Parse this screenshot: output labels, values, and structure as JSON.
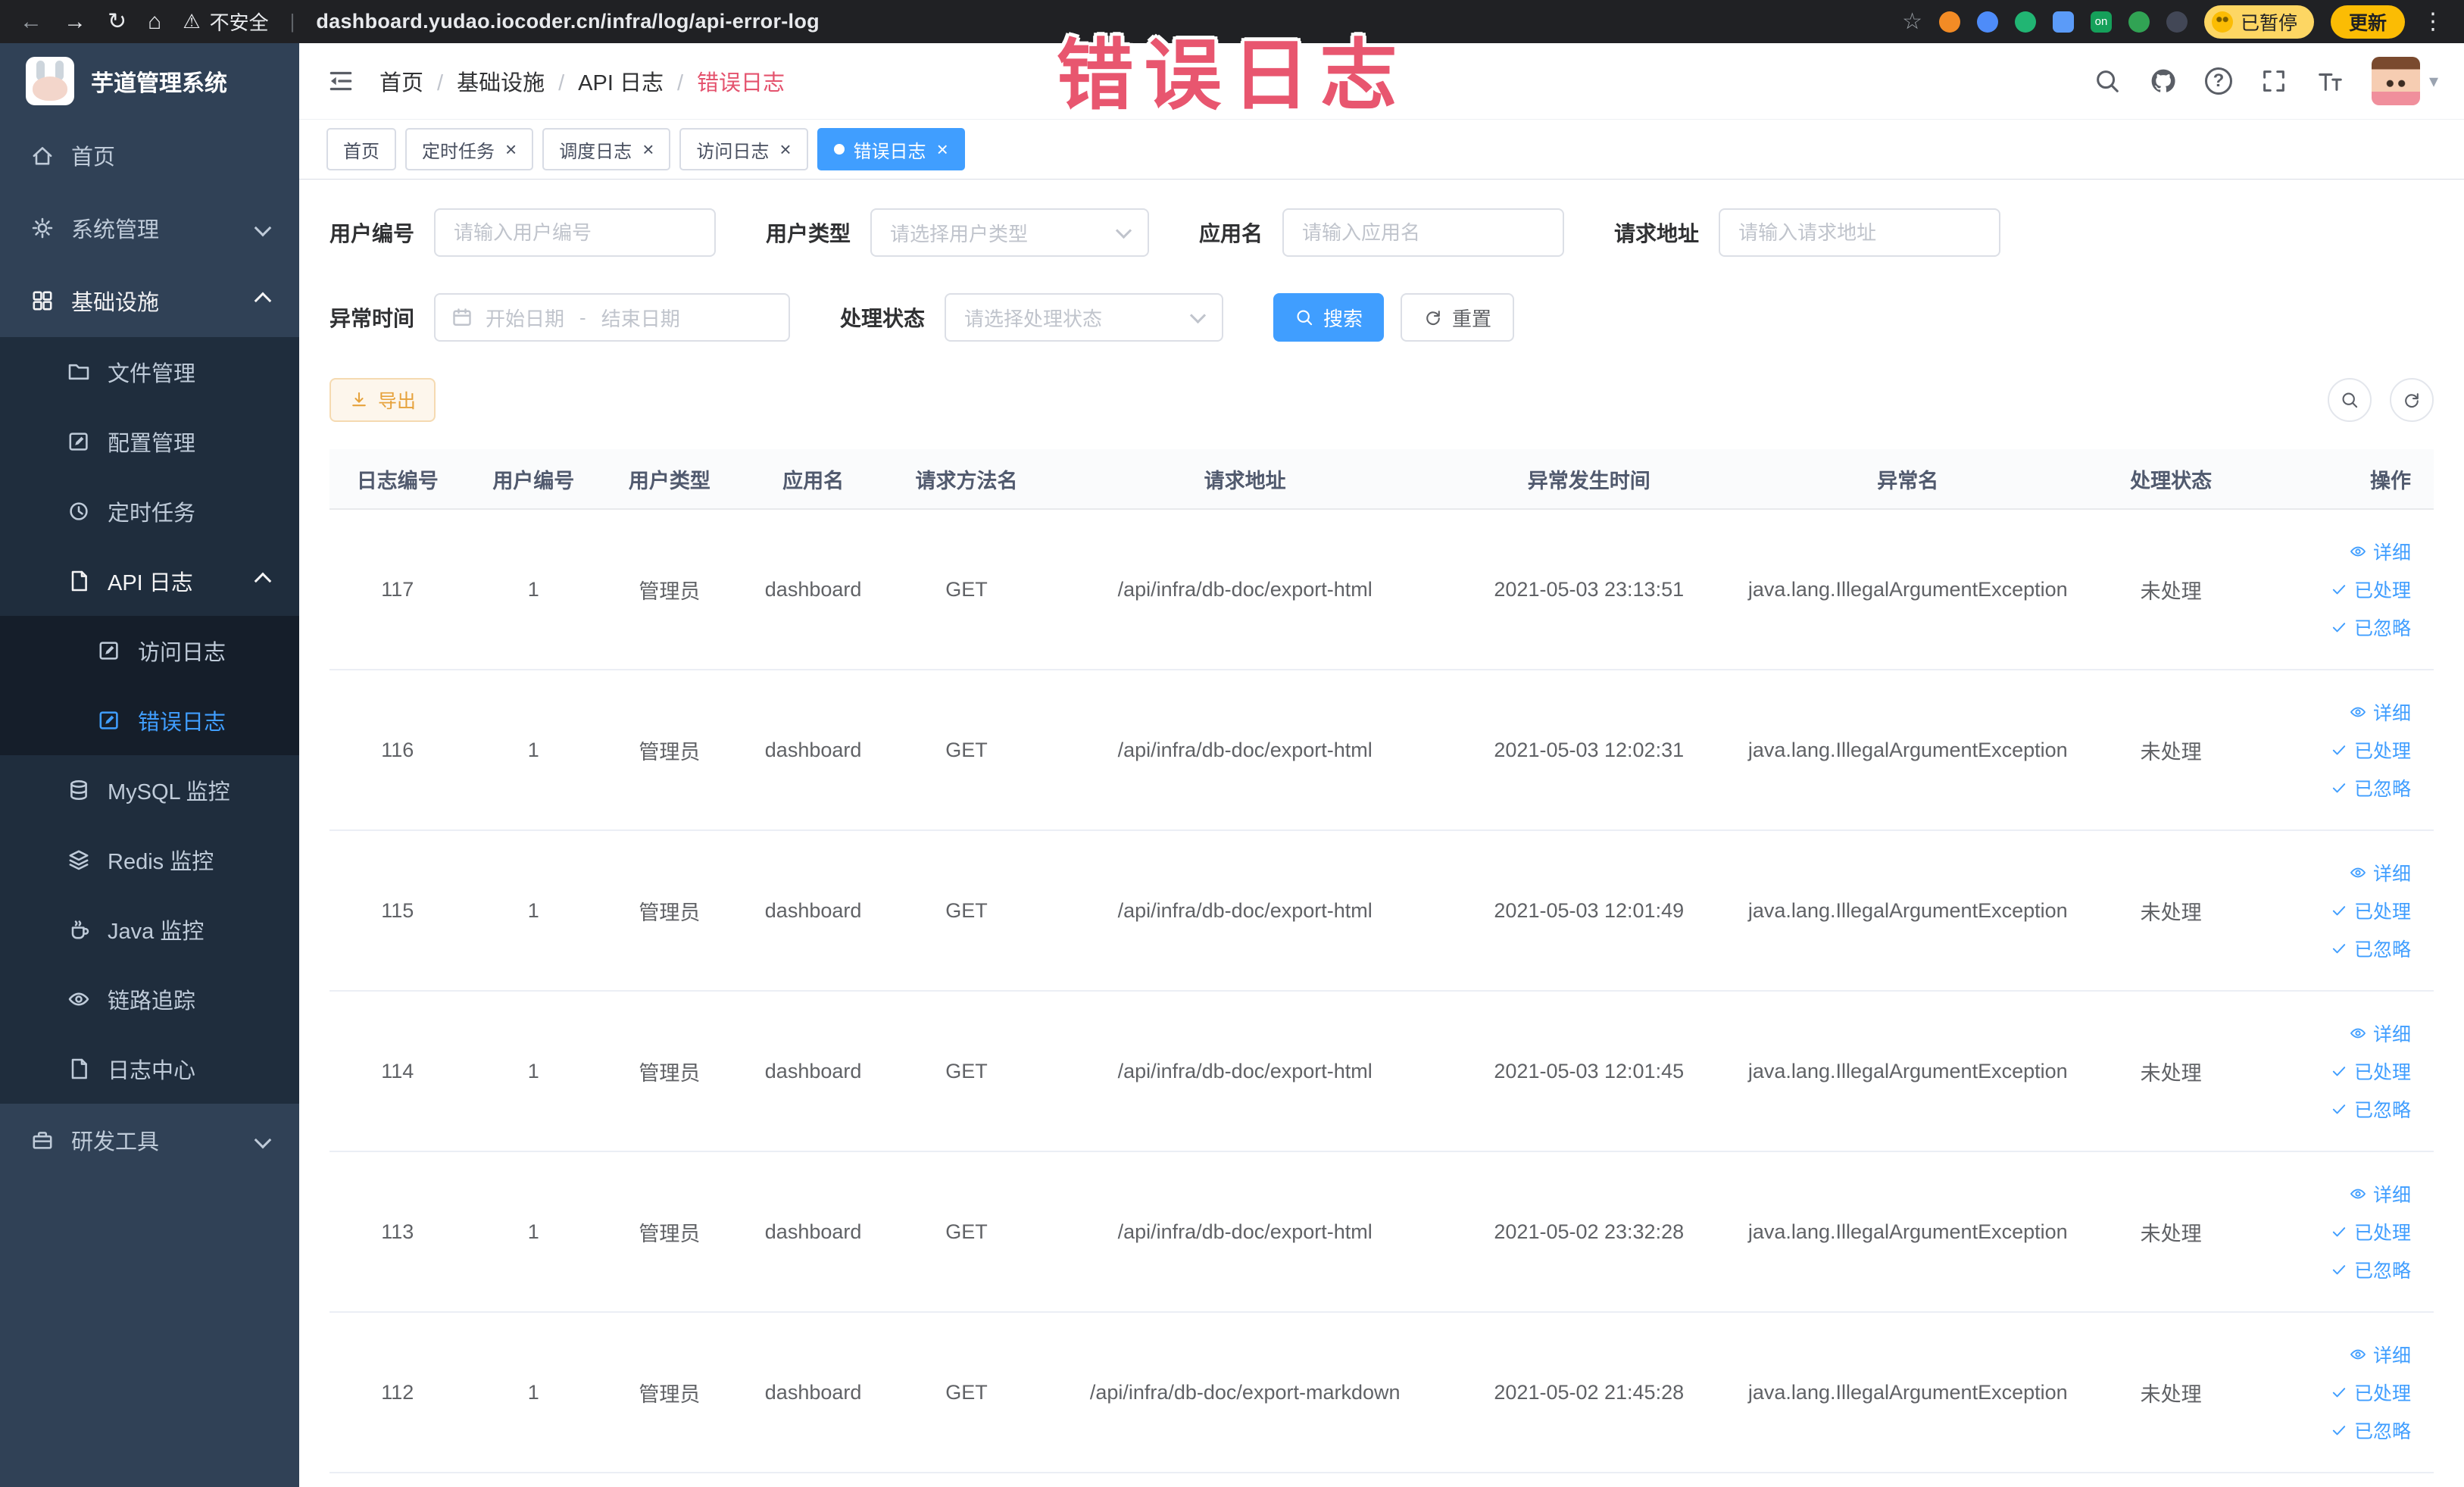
{
  "browser": {
    "security_label": "不安全",
    "url": "dashboard.yudao.iocoder.cn/infra/log/api-error-log",
    "paused_badge": "已暂停",
    "update_label": "更新"
  },
  "annotation_title": "错误日志",
  "icons": {
    "back": "←",
    "forward": "→",
    "reload": "↻",
    "home": "⌂",
    "warning": "⚠",
    "star": "☆",
    "menu_dots": "⋮",
    "close": "×",
    "help": "?",
    "caret": "▾",
    "url_divider": "|"
  },
  "colors": {
    "primary": "#409EFF",
    "warning": "#e6a23c",
    "annotation": "#e8566f",
    "sidebar_bg": "#304156"
  },
  "sidebar": {
    "logo_title": "芋道管理系统",
    "menu": [
      {
        "label": "首页"
      },
      {
        "label": "系统管理"
      },
      {
        "label": "基础设施"
      },
      {
        "label": "文件管理"
      },
      {
        "label": "配置管理"
      },
      {
        "label": "定时任务"
      },
      {
        "label": "API 日志"
      },
      {
        "label": "访问日志"
      },
      {
        "label": "错误日志"
      },
      {
        "label": "MySQL 监控"
      },
      {
        "label": "Redis 监控"
      },
      {
        "label": "Java 监控"
      },
      {
        "label": "链路追踪"
      },
      {
        "label": "日志中心"
      },
      {
        "label": "研发工具"
      }
    ]
  },
  "breadcrumb": {
    "items": [
      "首页",
      "基础设施",
      "API 日志",
      "错误日志"
    ]
  },
  "tabs": [
    {
      "label": "首页"
    },
    {
      "label": "定时任务"
    },
    {
      "label": "调度日志"
    },
    {
      "label": "访问日志"
    },
    {
      "label": "错误日志"
    }
  ],
  "filters": {
    "user_id_label": "用户编号",
    "user_id_placeholder": "请输入用户编号",
    "user_type_label": "用户类型",
    "user_type_placeholder": "请选择用户类型",
    "app_name_label": "应用名",
    "app_name_placeholder": "请输入应用名",
    "request_url_label": "请求地址",
    "request_url_placeholder": "请输入请求地址",
    "exception_time_label": "异常时间",
    "date_start_placeholder": "开始日期",
    "date_separator": "-",
    "date_end_placeholder": "结束日期",
    "process_status_label": "处理状态",
    "process_status_placeholder": "请选择处理状态",
    "search_label": "搜索",
    "reset_label": "重置"
  },
  "toolbar": {
    "export_label": "导出"
  },
  "table": {
    "columns": [
      "日志编号",
      "用户编号",
      "用户类型",
      "应用名",
      "请求方法名",
      "请求地址",
      "异常发生时间",
      "异常名",
      "处理状态",
      "操作"
    ],
    "action_detail": "详细",
    "action_processed": "已处理",
    "action_ignored": "已忽略",
    "rows": [
      {
        "id": "117",
        "user_id": "1",
        "user_type": "管理员",
        "app": "dashboard",
        "method": "GET",
        "url": "/api/infra/db-doc/export-html",
        "time": "2021-05-03 23:13:51",
        "exception": "java.lang.IllegalArgumentException",
        "status": "未处理"
      },
      {
        "id": "116",
        "user_id": "1",
        "user_type": "管理员",
        "app": "dashboard",
        "method": "GET",
        "url": "/api/infra/db-doc/export-html",
        "time": "2021-05-03 12:02:31",
        "exception": "java.lang.IllegalArgumentException",
        "status": "未处理"
      },
      {
        "id": "115",
        "user_id": "1",
        "user_type": "管理员",
        "app": "dashboard",
        "method": "GET",
        "url": "/api/infra/db-doc/export-html",
        "time": "2021-05-03 12:01:49",
        "exception": "java.lang.IllegalArgumentException",
        "status": "未处理"
      },
      {
        "id": "114",
        "user_id": "1",
        "user_type": "管理员",
        "app": "dashboard",
        "method": "GET",
        "url": "/api/infra/db-doc/export-html",
        "time": "2021-05-03 12:01:45",
        "exception": "java.lang.IllegalArgumentException",
        "status": "未处理"
      },
      {
        "id": "113",
        "user_id": "1",
        "user_type": "管理员",
        "app": "dashboard",
        "method": "GET",
        "url": "/api/infra/db-doc/export-html",
        "time": "2021-05-02 23:32:28",
        "exception": "java.lang.IllegalArgumentException",
        "status": "未处理"
      },
      {
        "id": "112",
        "user_id": "1",
        "user_type": "管理员",
        "app": "dashboard",
        "method": "GET",
        "url": "/api/infra/db-doc/export-markdown",
        "time": "2021-05-02 21:45:28",
        "exception": "java.lang.IllegalArgumentException",
        "status": "未处理"
      }
    ]
  }
}
